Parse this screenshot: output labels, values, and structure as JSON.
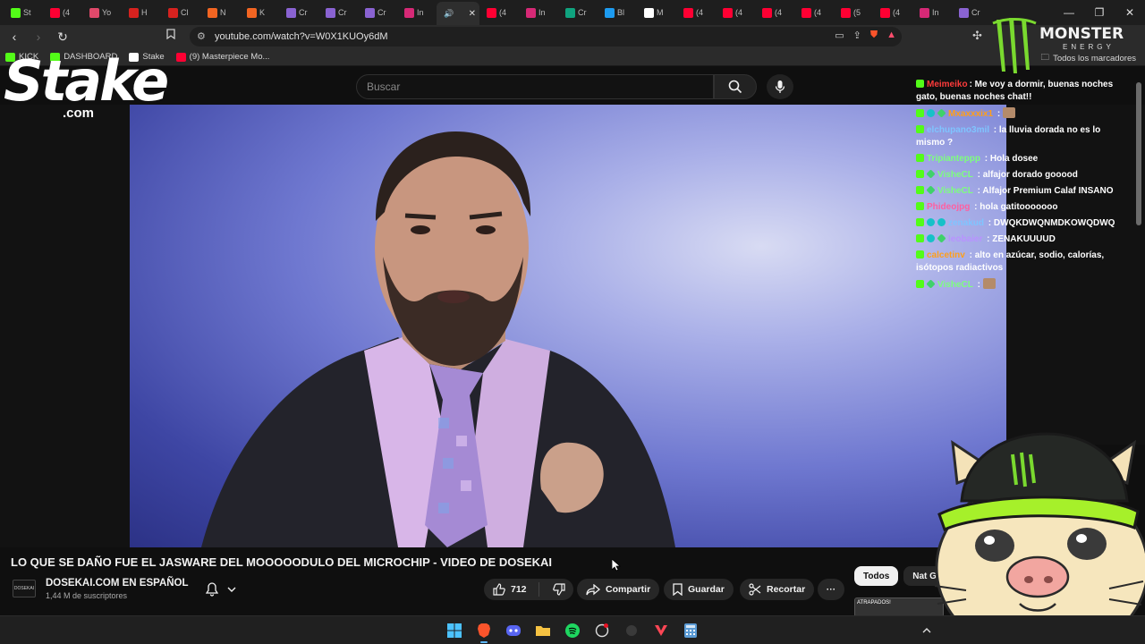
{
  "browser": {
    "tabs": [
      {
        "label": "St",
        "color": "#53fc18"
      },
      {
        "label": "(4",
        "color": "#ff0033"
      },
      {
        "label": "Yo",
        "color": "#e0496a"
      },
      {
        "label": "H",
        "color": "#d6221f"
      },
      {
        "label": "Cl",
        "color": "#d6221f"
      },
      {
        "label": "N",
        "color": "#f26522"
      },
      {
        "label": "K",
        "color": "#f26522"
      },
      {
        "label": "Cr",
        "color": "#8a63d2"
      },
      {
        "label": "Cr",
        "color": "#8a63d2"
      },
      {
        "label": "Cr",
        "color": "#8a63d2"
      },
      {
        "label": "In",
        "color": "#d62976"
      }
    ],
    "tabs_right": [
      {
        "label": "(4",
        "color": "#ff0033"
      },
      {
        "label": "In",
        "color": "#d62976"
      },
      {
        "label": "Cr",
        "color": "#10a37f"
      },
      {
        "label": "Bl",
        "color": "#1d9bf0"
      },
      {
        "label": "M",
        "color": "#ffffff"
      },
      {
        "label": "(4",
        "color": "#ff0033"
      },
      {
        "label": "(4",
        "color": "#ff0033"
      },
      {
        "label": "(4",
        "color": "#ff0033"
      },
      {
        "label": "(4",
        "color": "#ff0033"
      },
      {
        "label": "(5",
        "color": "#ff0033"
      },
      {
        "label": "(4",
        "color": "#ff0033"
      },
      {
        "label": "In",
        "color": "#d62976"
      },
      {
        "label": "Cr",
        "color": "#8a63d2"
      }
    ],
    "active_tab_close": "✕",
    "url": "youtube.com/watch?v=W0X1KUOy6dM",
    "bookmarks": [
      {
        "label": "KICK",
        "color": "#53fc18"
      },
      {
        "label": "DASHBOARD",
        "color": "#53fc18"
      },
      {
        "label": "Stake",
        "color": "#ffffff"
      },
      {
        "label": "(9) Masterpiece Mo...",
        "color": "#ff0033"
      }
    ],
    "all_bookmarks": "Todos los marcadores"
  },
  "youtube": {
    "search_placeholder": "Buscar",
    "video_title": "LO QUE SE DAÑO FUE EL JASWARE DEL MOOOOODULO DEL MICROCHIP - VIDEO DE DOSEKAI",
    "channel_name": "DOSEKAI.COM EN ESPAÑOL",
    "channel_subs": "1,44 M de suscriptores",
    "channel_avatar_text": "DOSEKAI",
    "likes": "712",
    "share_label": "Compartir",
    "save_label": "Guardar",
    "clip_label": "Recortar",
    "more_label": "···",
    "chips": [
      "Todos",
      "Nat Geo"
    ],
    "related_thumb_text": "ATRAPADOS!"
  },
  "overlay": {
    "stake_word": "Stake",
    "stake_domain": ".com",
    "monster_brand": "MONSTER",
    "monster_sub": "ENERGY"
  },
  "chat": [
    {
      "user": "Meimeiko",
      "color": "#ff3b3b",
      "text": ": Me voy a dormir, buenas noches gato, buenas noches chat!!",
      "badges": [
        "k"
      ]
    },
    {
      "user": "Mxaxxxix1",
      "color": "#ff9f1a",
      "text": " : ",
      "badges": [
        "k",
        "s",
        "g"
      ],
      "emote": true
    },
    {
      "user": "elchupano3mil",
      "color": "#7fc4ff",
      "text": " : la lluvia dorada no es lo mismo ?",
      "badges": [
        "k"
      ]
    },
    {
      "user": "Tripianteppp",
      "color": "#7dff7d",
      "text": " : Hola dosee",
      "badges": [
        "k"
      ]
    },
    {
      "user": "VisheCL",
      "color": "#7dff7d",
      "text": " : alfajor dorado gooood",
      "badges": [
        "k",
        "g"
      ]
    },
    {
      "user": "VisheCL",
      "color": "#7dff7d",
      "text": " : Alfajor Premium Calaf INSANO",
      "badges": [
        "k",
        "g"
      ]
    },
    {
      "user": "Phideojpg",
      "color": "#ff5fa0",
      "text": " : hola gatitooooooo",
      "badges": [
        "k"
      ]
    },
    {
      "user": "zenakud",
      "color": "#7fc4ff",
      "text": " : DWQKDWQNMDKOWQDWQ",
      "badges": [
        "k",
        "s",
        "s"
      ]
    },
    {
      "user": "leobaier",
      "color": "#b892ff",
      "text": " : ZENAKUUUUD",
      "badges": [
        "k",
        "s",
        "g"
      ]
    },
    {
      "user": "calcetinv",
      "color": "#ff9f1a",
      "text": " : alto en azúcar, sodio, calorías, isótopos radiactivos",
      "badges": [
        "k"
      ]
    },
    {
      "user": "VisheCL",
      "color": "#7dff7d",
      "text": " : ",
      "badges": [
        "k",
        "g"
      ],
      "emote": true
    }
  ]
}
